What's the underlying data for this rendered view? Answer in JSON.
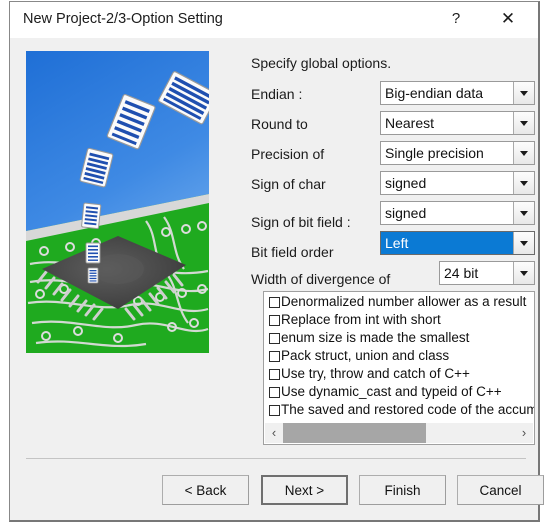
{
  "window": {
    "title": "New Project-2/3-Option Setting",
    "help_label": "?",
    "close_label": "✕"
  },
  "illustration": {
    "name": "documents-flying-into-chip-on-pcb",
    "sky_color": "#2f7fdd",
    "board_color": "#1faa1f",
    "chip_color": "#4a4a4a"
  },
  "form": {
    "instruction": "Specify global options.",
    "fields": [
      {
        "label": "Endian :",
        "value": "Big-endian data",
        "selected": false
      },
      {
        "label": "Round to",
        "value": "Nearest",
        "selected": false
      },
      {
        "label": "Precision of",
        "value": "Single precision",
        "selected": false
      },
      {
        "label": "Sign of char",
        "value": "signed",
        "selected": false
      },
      {
        "label": "Sign of bit field :",
        "value": "signed",
        "selected": false
      },
      {
        "label": "Bit field order",
        "value": "Left",
        "selected": true
      },
      {
        "label": "Width of divergence of",
        "value": "24 bit",
        "selected": false
      }
    ]
  },
  "option_list": {
    "items": [
      {
        "label": "Denormalized number allower as a result",
        "checked": false
      },
      {
        "label": "Replace from int with short",
        "checked": false
      },
      {
        "label": "enum size is made the smallest",
        "checked": false
      },
      {
        "label": "Pack struct, union and class",
        "checked": false
      },
      {
        "label": "Use try, throw and catch of C++",
        "checked": false
      },
      {
        "label": "Use dynamic_cast and typeid of C++",
        "checked": false
      },
      {
        "label": "The saved and restored code of the accumulator",
        "checked": false
      }
    ],
    "scroll_left_label": "‹",
    "scroll_right_label": "›"
  },
  "buttons": {
    "back": "< Back",
    "next": "Next >",
    "finish": "Finish",
    "cancel": "Cancel"
  },
  "highlight_color": "#0b7ad4"
}
